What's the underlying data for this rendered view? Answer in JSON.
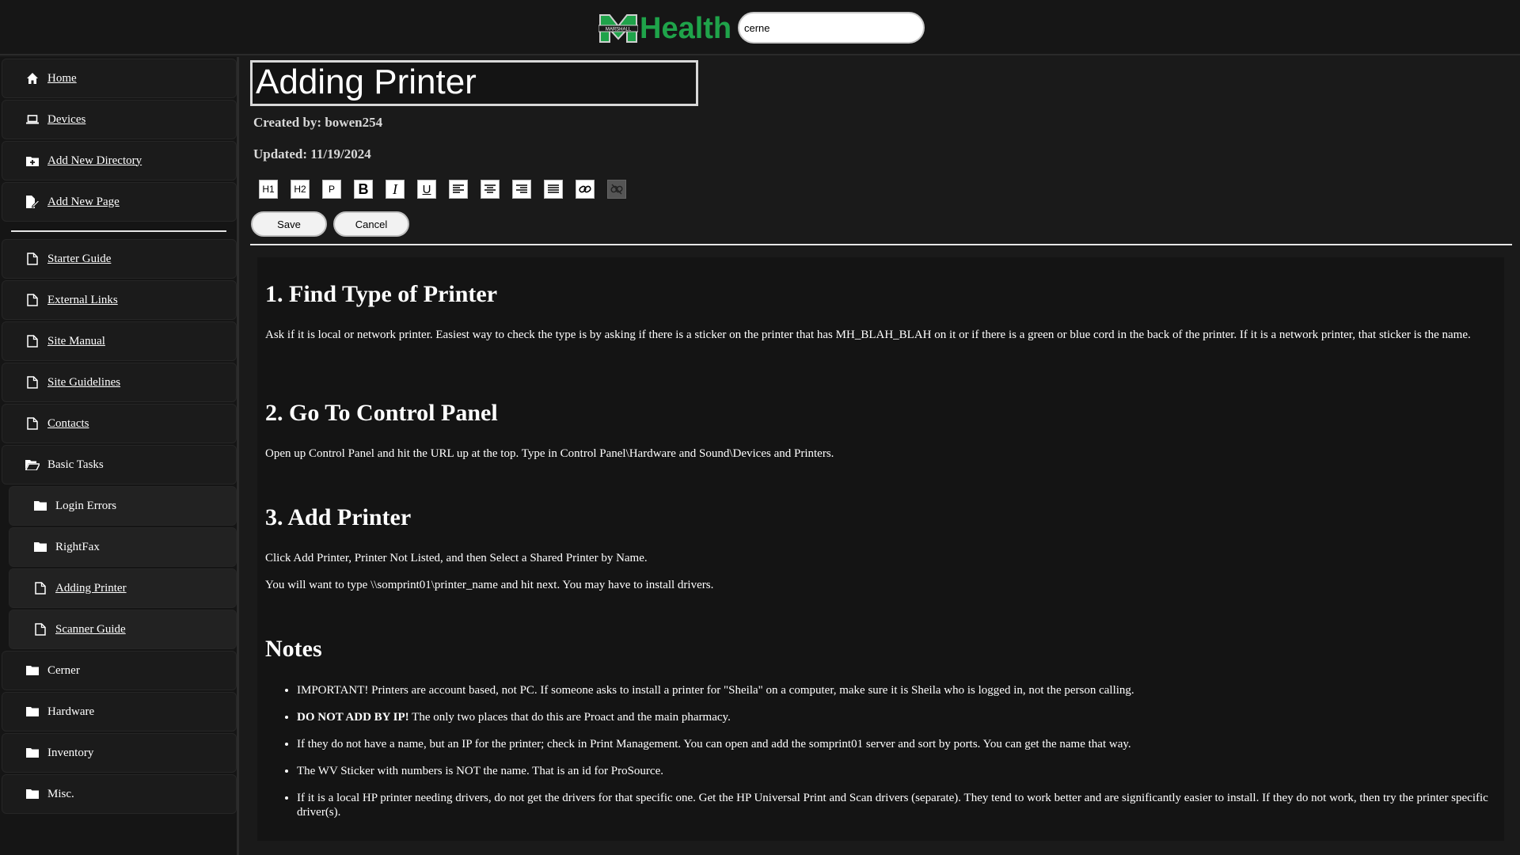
{
  "header": {
    "brand_text": "Health",
    "logo_text": "MARSHALL",
    "search_value": "cerne"
  },
  "sidebar": {
    "items": [
      {
        "label": "Home",
        "icon": "home-icon"
      },
      {
        "label": "Devices",
        "icon": "laptop-icon"
      },
      {
        "label": "Add New Directory",
        "icon": "folder-plus-icon"
      },
      {
        "label": "Add New Page",
        "icon": "file-edit-icon"
      },
      {
        "label": "Starter Guide",
        "icon": "file-icon"
      },
      {
        "label": "External Links",
        "icon": "file-icon"
      },
      {
        "label": "Site Manual",
        "icon": "file-icon"
      },
      {
        "label": "Site Guidelines",
        "icon": "file-icon"
      },
      {
        "label": "Contacts",
        "icon": "file-icon"
      },
      {
        "label": "Basic Tasks",
        "icon": "folder-open-icon"
      },
      {
        "label": "Login Errors",
        "icon": "folder-icon"
      },
      {
        "label": "RightFax",
        "icon": "folder-icon"
      },
      {
        "label": "Adding Printer",
        "icon": "file-icon"
      },
      {
        "label": "Scanner Guide",
        "icon": "file-icon"
      },
      {
        "label": "Cerner",
        "icon": "folder-icon"
      },
      {
        "label": "Hardware",
        "icon": "folder-icon"
      },
      {
        "label": "Inventory",
        "icon": "folder-icon"
      },
      {
        "label": "Misc.",
        "icon": "folder-icon"
      }
    ]
  },
  "page": {
    "title": "Adding Printer",
    "created_by": "Created by: bowen254",
    "updated": "Updated: 11/19/2024"
  },
  "toolbar": {
    "h1": "H1",
    "h2": "H2",
    "p": "P",
    "bold": "B",
    "italic": "I",
    "underline": "U",
    "save_label": "Save",
    "cancel_label": "Cancel"
  },
  "content": {
    "h1_1": "1. Find Type of Printer",
    "p1": "Ask if it is local or network printer. Easiest way to check the type is by asking if there is a sticker on the printer that has MH_BLAH_BLAH on it or if there is a green or blue cord in the back of the printer. If it is a network printer, that sticker is the name.",
    "h1_2": "2. Go To Control Panel",
    "p2": "Open up Control Panel and hit the URL up at the top. Type in Control Panel\\Hardware and Sound\\Devices and Printers.",
    "h1_3": "3. Add Printer",
    "p3": "Click Add Printer, Printer Not Listed, and then Select a Shared Printer by Name.",
    "p4": "You will want to type \\\\somprint01\\printer_name and hit next. You may have to install drivers.",
    "h1_4": "Notes",
    "notes": [
      "IMPORTANT! Printers are account based, not PC. If someone asks to install a printer for \"Sheila\" on a computer, make sure it is Sheila who is logged in, not the person calling.",
      "The only two places that do this are Proact and the main pharmacy.",
      "If they do not have a name, but an IP for the printer; check in Print Management. You can open and add the somprint01 server and sort by ports. You can get the name that way.",
      "The WV Sticker with numbers is NOT the name. That is an id for ProSource.",
      "If it is a local HP printer needing drivers, do not get the drivers for that specific one. Get the HP Universal Print and Scan drivers (separate). They tend to work better and are significantly easier to install. If they do not work, then try the printer specific driver(s)."
    ],
    "note2_bold": "DO NOT ADD BY IP!"
  }
}
